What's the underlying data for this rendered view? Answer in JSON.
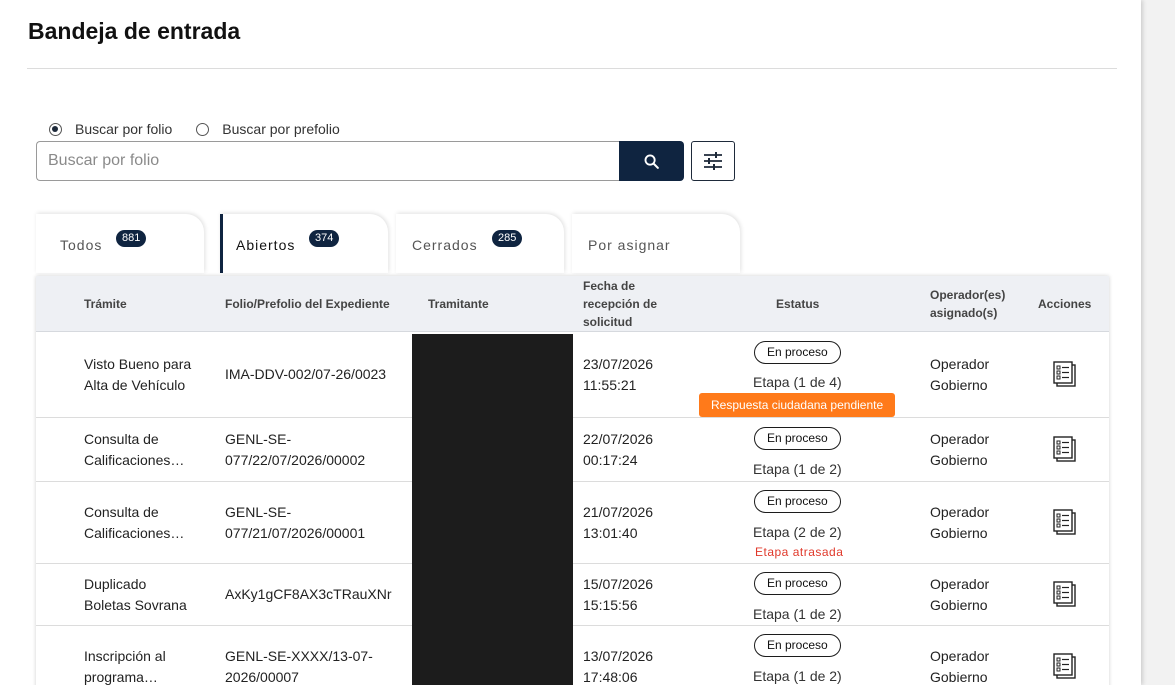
{
  "page": {
    "title": "Bandeja de entrada"
  },
  "search": {
    "options": [
      {
        "label": "Buscar por folio",
        "selected": true
      },
      {
        "label": "Buscar por prefolio",
        "selected": false
      }
    ],
    "placeholder": "Buscar por folio",
    "value": "",
    "search_icon": "search-icon",
    "filter_icon": "sliders-icon",
    "button_color": "#0f2440"
  },
  "tabs": [
    {
      "label": "Todos",
      "count": "881",
      "active": false
    },
    {
      "label": "Abiertos",
      "count": "374",
      "active": true
    },
    {
      "label": "Cerrados",
      "count": "285",
      "active": false
    },
    {
      "label": "Por asignar",
      "count": "",
      "active": false
    }
  ],
  "table": {
    "headers": {
      "tramite": "Trámite",
      "folio": "Folio/Prefolio del Expediente",
      "tramitante": "Tramitante",
      "fecha": "Fecha de recepción de solicitud",
      "estatus": "Estatus",
      "operador": "Operador(es) asignado(s)",
      "acciones": "Acciones"
    },
    "rows": [
      {
        "tramite": "Visto Bueno para Alta de Vehículo",
        "folio": "IMA-DDV-002/07-26/0023",
        "fecha_date": "23/07/2026",
        "fecha_time": "11:55:21",
        "status": "En proceso",
        "etapa": "Etapa (1 de 4)",
        "note": "Respuesta ciudadana pendiente",
        "note_type": "warning",
        "operador": "Operador Gobierno"
      },
      {
        "tramite": "Consulta de Calificaciones Escolares",
        "folio": "GENL-SE-077/22/07/2026/00002",
        "fecha_date": "22/07/2026",
        "fecha_time": "00:17:24",
        "status": "En proceso",
        "etapa": "Etapa (1 de 2)",
        "note": "",
        "note_type": "",
        "operador": "Operador Gobierno"
      },
      {
        "tramite": "Consulta de Calificaciones Escolares",
        "folio": "GENL-SE-077/21/07/2026/00001",
        "fecha_date": "21/07/2026",
        "fecha_time": "13:01:40",
        "status": "En proceso",
        "etapa": "Etapa (2 de 2)",
        "note": "Etapa atrasada",
        "note_type": "late",
        "operador": "Operador Gobierno"
      },
      {
        "tramite": "Duplicado Boletas Sovrana",
        "folio": "AxKy1gCF8AX3cTRauXNr",
        "fecha_date": "15/07/2026",
        "fecha_time": "15:15:56",
        "status": "En proceso",
        "etapa": "Etapa (1 de 2)",
        "note": "",
        "note_type": "",
        "operador": "Operador Gobierno"
      },
      {
        "tramite": "Inscripción al programa Certificado",
        "folio": "GENL-SE-XXXX/13-07-2026/00007",
        "fecha_date": "13/07/2026",
        "fecha_time": "17:48:06",
        "status": "En proceso",
        "etapa": "Etapa (1 de 2)",
        "note": "",
        "note_type": "",
        "operador": "Operador Gobierno"
      }
    ],
    "action_icon": "document-list-icon"
  },
  "colors": {
    "navy": "#0f2440",
    "warning": "#ff7a1a",
    "late": "#e0392b"
  }
}
